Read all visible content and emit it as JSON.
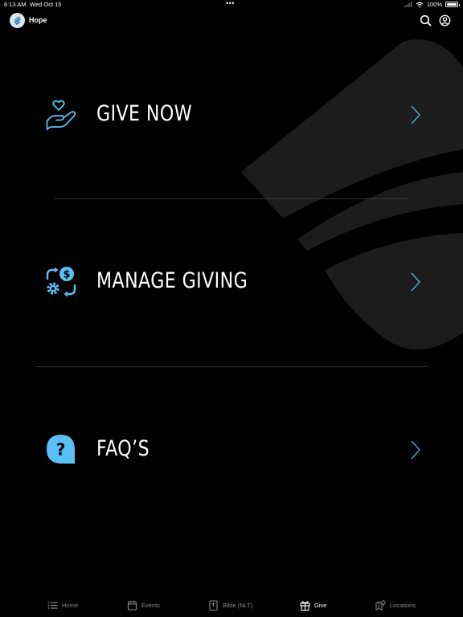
{
  "status_bar": {
    "time": "6:13 AM",
    "date": "Wed Oct 15",
    "battery": "100%"
  },
  "header": {
    "app_name": "Hope"
  },
  "menu": [
    {
      "label": "GIVE NOW",
      "icon": "hand-heart-icon"
    },
    {
      "label": "MANAGE GIVING",
      "icon": "settings-dollar-icon"
    },
    {
      "label": "FAQ’S",
      "icon": "question-bubble-icon"
    }
  ],
  "tabs": [
    {
      "label": "Home",
      "icon": "list-icon",
      "active": false
    },
    {
      "label": "Events",
      "icon": "calendar-icon",
      "active": false
    },
    {
      "label": "Bible (NLT)",
      "icon": "bible-icon",
      "active": false
    },
    {
      "label": "Give",
      "icon": "gift-icon",
      "active": true
    },
    {
      "label": "Locations",
      "icon": "map-pin-icon",
      "active": false
    }
  ],
  "colors": {
    "accent": "#5bc0f5",
    "background": "#000000",
    "inactive_tab": "#8a8a8a",
    "watermark": "#1c1c1c"
  }
}
